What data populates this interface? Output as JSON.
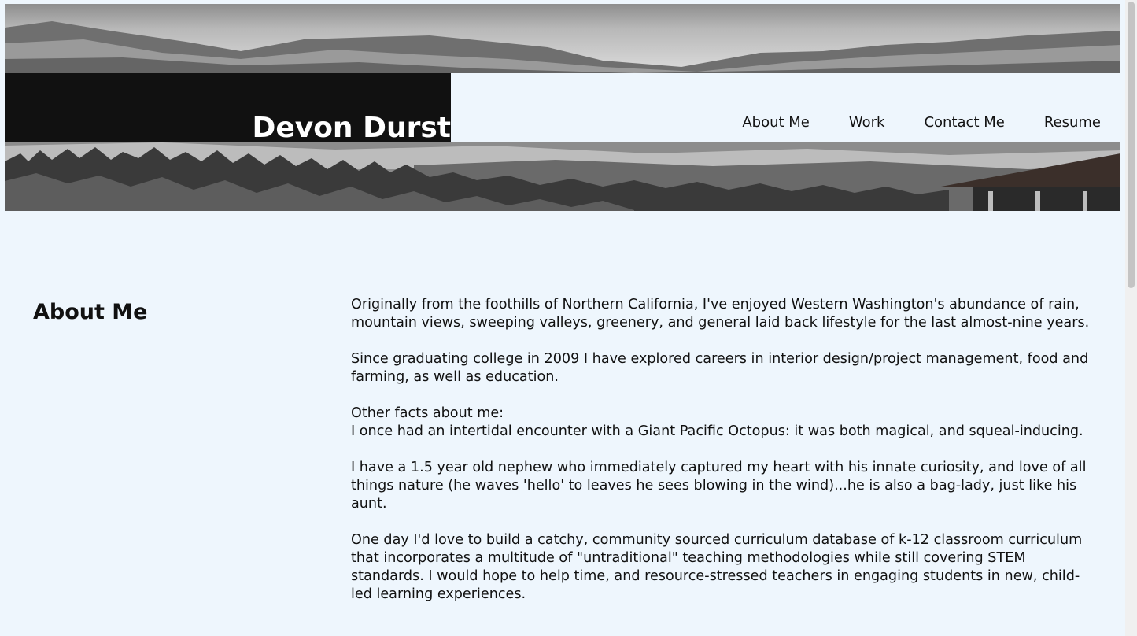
{
  "header": {
    "site_title": "Devon Durst",
    "nav": [
      "About Me",
      "Work",
      "Contact Me",
      "Resume"
    ]
  },
  "about": {
    "heading": "About Me",
    "paragraphs": [
      "Originally from the foothills of Northern California, I've enjoyed Western Washington's abundance of rain, mountain views, sweeping valleys, greenery, and general laid back lifestyle for the last almost-nine years.",
      "Since graduating college in 2009 I have explored careers in interior design/project management, food and farming, as well as education.",
      "Other facts about me:",
      "I once had an intertidal encounter with a Giant Pacific Octopus: it was both magical, and squeal-inducing.",
      "I have a 1.5 year old nephew who immediately captured my heart with his innate curiosity, and love of all things nature (he waves 'hello' to leaves he sees blowing in the wind)...he is also a bag-lady, just like his aunt.",
      "One day I'd love to build a catchy, community sourced curriculum database of k-12 classroom curriculum that incorporates a multitude of \"untraditional\" teaching methodologies while still covering STEM standards. I would hope to help time, and resource-stressed teachers in engaging students in new, child-led learning experiences."
    ]
  },
  "colors": {
    "page_background": "#eef6fd",
    "title_box": "#111111",
    "title_text": "#ffffff"
  }
}
